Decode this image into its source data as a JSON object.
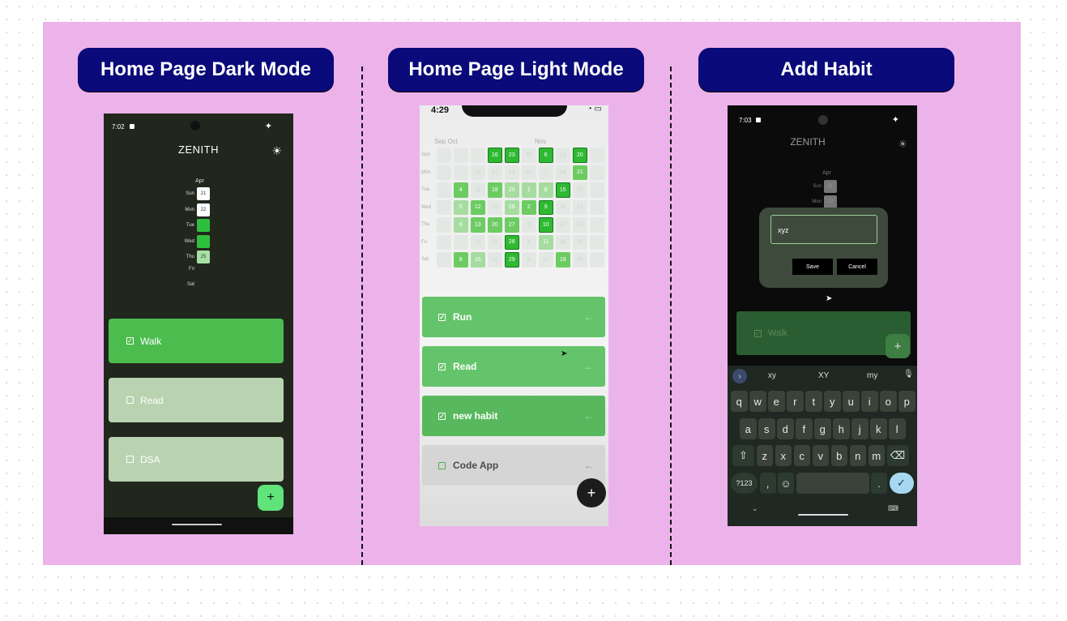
{
  "panels": {
    "dark_title": "Home Page Dark Mode",
    "light_title": "Home Page Light Mode",
    "add_title": "Add Habit"
  },
  "phone_dark": {
    "time": "7:02",
    "app_title": "ZENITH",
    "month": "Apr",
    "days": [
      {
        "label": "Sun",
        "date": "21",
        "color": "#ffffff"
      },
      {
        "label": "Mon",
        "date": "22",
        "color": "#ffffff"
      },
      {
        "label": "Tue",
        "date": "",
        "color": "#2fbf3e"
      },
      {
        "label": "Wed",
        "date": "",
        "color": "#2fbf3e"
      },
      {
        "label": "Thu",
        "date": "25",
        "color": "#a8e0a4"
      },
      {
        "label": "Fri",
        "date": "",
        "color": ""
      },
      {
        "label": "Sat",
        "date": "",
        "color": ""
      }
    ],
    "habits": [
      {
        "name": "Walk",
        "checked": true
      },
      {
        "name": "Read",
        "checked": false
      },
      {
        "name": "DSA",
        "checked": false
      }
    ],
    "fab": "+"
  },
  "phone_light": {
    "time": "4:29",
    "months": [
      "Sep Oct",
      "Nov"
    ],
    "rows": [
      {
        "label": "Sun",
        "cells": [
          [
            "",
            0
          ],
          [
            "",
            0
          ],
          [
            "",
            0
          ],
          [
            "16",
            3
          ],
          [
            "23",
            3
          ],
          [
            "30",
            0
          ],
          [
            "6",
            3
          ],
          [
            "13",
            0
          ],
          [
            "20",
            3
          ],
          [
            "",
            0
          ]
        ]
      },
      {
        "label": "Mon",
        "cells": [
          [
            "",
            0
          ],
          [
            "",
            0
          ],
          [
            "10",
            0
          ],
          [
            "17",
            0
          ],
          [
            "24",
            0
          ],
          [
            "31",
            0
          ],
          [
            "7",
            0
          ],
          [
            "14",
            0
          ],
          [
            "21",
            2
          ],
          [
            "",
            0
          ]
        ]
      },
      {
        "label": "Tue",
        "cells": [
          [
            "",
            0
          ],
          [
            "4",
            2
          ],
          [
            "11",
            0
          ],
          [
            "18",
            2
          ],
          [
            "25",
            1
          ],
          [
            "1",
            1
          ],
          [
            "8",
            1
          ],
          [
            "15",
            3
          ],
          [
            "22",
            0
          ],
          [
            "",
            0
          ]
        ]
      },
      {
        "label": "Wed",
        "cells": [
          [
            "",
            0
          ],
          [
            "5",
            1
          ],
          [
            "12",
            2
          ],
          [
            "19",
            0
          ],
          [
            "26",
            1
          ],
          [
            "2",
            2
          ],
          [
            "9",
            3
          ],
          [
            "16",
            0
          ],
          [
            "23",
            0
          ],
          [
            "",
            0
          ]
        ]
      },
      {
        "label": "Thu",
        "cells": [
          [
            "",
            0
          ],
          [
            "6",
            1
          ],
          [
            "13",
            2
          ],
          [
            "20",
            2
          ],
          [
            "27",
            2
          ],
          [
            "3",
            0
          ],
          [
            "10",
            3
          ],
          [
            "17",
            0
          ],
          [
            "24",
            0
          ],
          [
            "",
            0
          ]
        ]
      },
      {
        "label": "Fri",
        "cells": [
          [
            "",
            0
          ],
          [
            "",
            0
          ],
          [
            "14",
            0
          ],
          [
            "21",
            0
          ],
          [
            "28",
            3
          ],
          [
            "4",
            0
          ],
          [
            "11",
            1
          ],
          [
            "18",
            0
          ],
          [
            "25",
            0
          ],
          [
            "",
            0
          ]
        ]
      },
      {
        "label": "Sat",
        "cells": [
          [
            "",
            0
          ],
          [
            "8",
            2
          ],
          [
            "15",
            1
          ],
          [
            "22",
            0
          ],
          [
            "29",
            3
          ],
          [
            "5",
            0
          ],
          [
            "12",
            0
          ],
          [
            "19",
            2
          ],
          [
            "26",
            0
          ],
          [
            "",
            0
          ]
        ]
      }
    ],
    "habits": [
      {
        "name": "Run",
        "checked": true
      },
      {
        "name": "Read",
        "checked": true
      },
      {
        "name": "new habit",
        "checked": true
      },
      {
        "name": "Code App",
        "checked": false
      }
    ],
    "arrow": "←",
    "fab": "+"
  },
  "phone_add": {
    "time": "7:03",
    "app_title": "ZENITH",
    "month": "Apr",
    "days": [
      {
        "label": "Sun",
        "date": "21"
      },
      {
        "label": "Mon",
        "date": "22"
      }
    ],
    "input_value": "xyz",
    "save_label": "Save",
    "cancel_label": "Cancel",
    "habit": "Walk",
    "fab": "+",
    "suggestions": [
      "xy",
      "XY",
      "my"
    ],
    "keys_row1": [
      "q",
      "w",
      "e",
      "r",
      "t",
      "y",
      "u",
      "i",
      "o",
      "p"
    ],
    "keys_row1_hints": [
      "1",
      "2",
      "3",
      "4",
      "5",
      "6",
      "7",
      "8",
      "9",
      "0"
    ],
    "keys_row2": [
      "a",
      "s",
      "d",
      "f",
      "g",
      "h",
      "j",
      "k",
      "l"
    ],
    "keys_row3": [
      "⇧",
      "z",
      "x",
      "c",
      "v",
      "b",
      "n",
      "m",
      "⌫"
    ],
    "sym_key": "?123",
    "comma_key": ",",
    "emoji_key": "☺",
    "period_key": ".",
    "enter_key": "✓"
  }
}
